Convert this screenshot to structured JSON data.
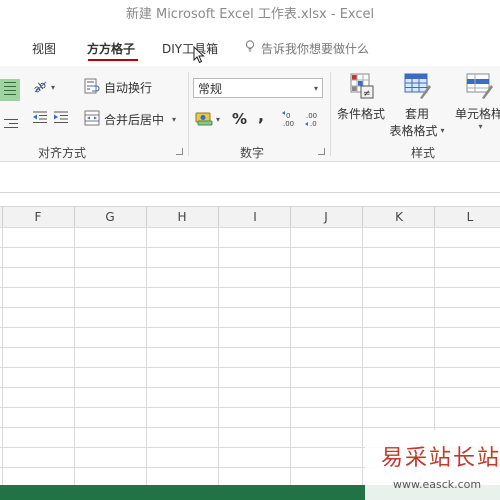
{
  "window": {
    "title": "新建 Microsoft Excel 工作表.xlsx - Excel"
  },
  "menu": {
    "items": [
      {
        "label": "视图"
      },
      {
        "label": "方方格子",
        "active": true
      },
      {
        "label": "DIY工具箱"
      }
    ],
    "tell_me": "告诉我你想要做什么"
  },
  "ribbon": {
    "alignment": {
      "wrap_text": "自动换行",
      "merge_center": "合并后居中",
      "group_label": "对齐方式"
    },
    "number": {
      "format_value": "常规",
      "percent": "%",
      "comma": ",",
      "group_label": "数字"
    },
    "styles": {
      "conditional": "条件格式",
      "table_line1": "套用",
      "table_line2": "表格格式",
      "cell_styles": "单元格样",
      "group_label": "样式"
    }
  },
  "sheet": {
    "columns": [
      "F",
      "G",
      "H",
      "I",
      "J",
      "K",
      "L"
    ]
  },
  "watermark": {
    "title": "易采站长站",
    "url": "www.easck.com"
  },
  "colors": {
    "accent": "#217346",
    "active_tab_underline": "#c00000"
  }
}
